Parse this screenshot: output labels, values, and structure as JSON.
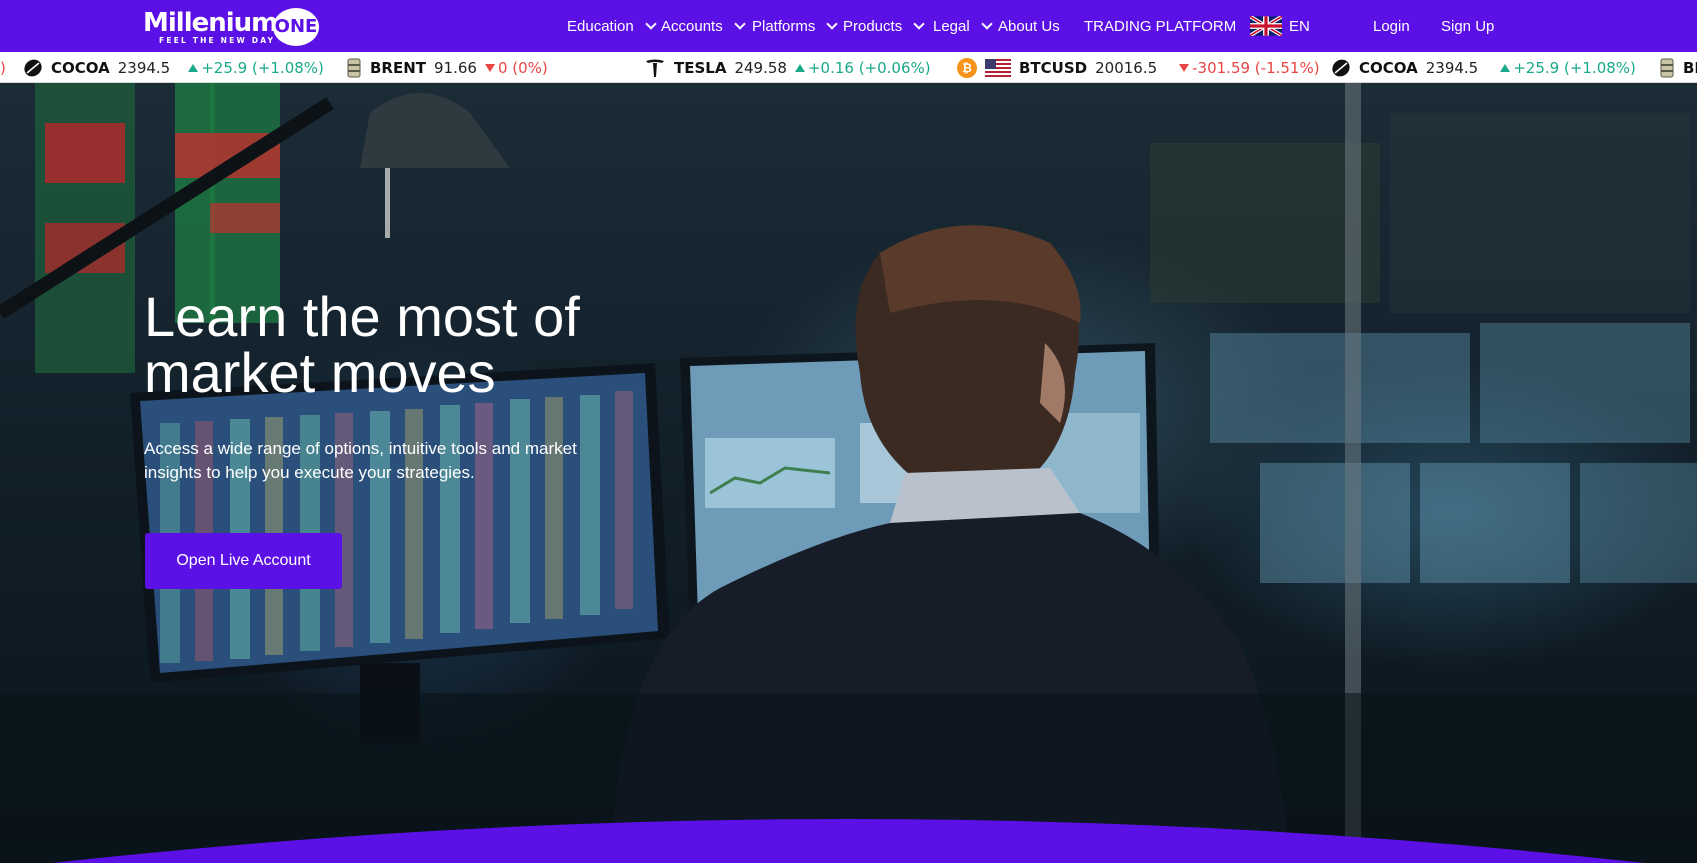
{
  "brand": {
    "name": "Millenium",
    "name_suffix": "ONE",
    "tagline": "FEEL THE NEW DAY",
    "color": "#5b10e6"
  },
  "nav": {
    "items": [
      {
        "label": "Education",
        "dropdown": true
      },
      {
        "label": "Accounts",
        "dropdown": true
      },
      {
        "label": "Platforms",
        "dropdown": true
      },
      {
        "label": "Products",
        "dropdown": true
      },
      {
        "label": "Legal",
        "dropdown": true
      },
      {
        "label": "About Us",
        "dropdown": false
      },
      {
        "label": "TRADING PLATFORM",
        "dropdown": false
      }
    ],
    "language": {
      "label": "EN",
      "flag_icon": "uk-flag-icon"
    },
    "login": "Login",
    "signup": "Sign Up"
  },
  "ticker": [
    {
      "symbol": "",
      "price": "",
      "change": ")",
      "direction": "down",
      "icon": "none"
    },
    {
      "symbol": "COCOA",
      "price": "2394.5",
      "change": "+25.9 (+1.08%)",
      "direction": "up",
      "icon": "cocoa-bean-icon"
    },
    {
      "symbol": "BRENT",
      "price": "91.66",
      "change": "0 (0%)",
      "direction": "down",
      "icon": "oil-barrel-icon"
    },
    {
      "symbol": "TESLA",
      "price": "249.58",
      "change": "+0.16 (+0.06%)",
      "direction": "up",
      "icon": "tesla-logo-icon"
    },
    {
      "symbol": "BTCUSD",
      "price": "20016.5",
      "change": "-301.59 (-1.51%)",
      "direction": "down",
      "icon": "bitcoin-icon"
    },
    {
      "symbol": "COCOA",
      "price": "2394.5",
      "change": "+25.9 (+1.08%)",
      "direction": "up",
      "icon": "cocoa-bean-icon"
    },
    {
      "symbol": "BI",
      "price": "",
      "change": "",
      "direction": "up",
      "icon": "oil-barrel-icon"
    }
  ],
  "hero": {
    "title_line1": "Learn the most of",
    "title_line2": "market moves",
    "subtitle": "Access a wide range of options, intuitive tools and market insights to help you execute your strategies.",
    "cta_label": "Open Live Account"
  },
  "colors": {
    "up": "#1aa88a",
    "down": "#e84545",
    "accent": "#5b10e6"
  }
}
